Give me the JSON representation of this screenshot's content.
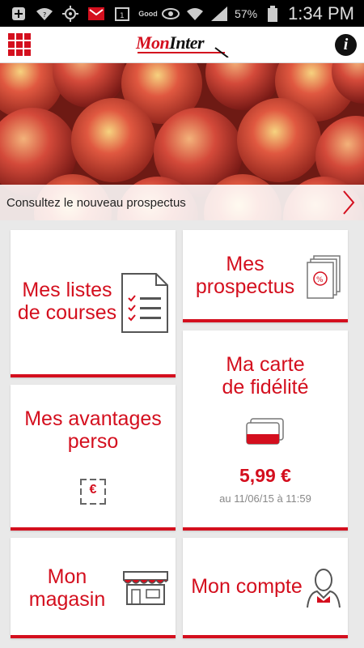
{
  "status_bar": {
    "battery": "57%",
    "time": "1:34 PM",
    "notif_label": "Good"
  },
  "app_bar": {
    "logo_mon": "Mon",
    "logo_inter": "Inter",
    "info_label": "i"
  },
  "banner": {
    "text": "Consultez le nouveau prospectus"
  },
  "tiles": {
    "lists": {
      "line1": "Mes listes",
      "line2": "de courses"
    },
    "prospectus": {
      "line1": "Mes",
      "line2": "prospectus"
    },
    "avantages": {
      "line1": "Mes avantages",
      "line2": "perso",
      "icon_label": "€"
    },
    "fidelite": {
      "line1": "Ma carte",
      "line2": "de fidélité",
      "amount": "5,99 €",
      "date": "au 11/06/15 à 11:59"
    },
    "magasin": {
      "line1": "Mon",
      "line2": "magasin"
    },
    "compte": {
      "line1": "Mon compte"
    }
  },
  "colors": {
    "accent": "#d40f1e",
    "background": "#e9e9e9"
  }
}
